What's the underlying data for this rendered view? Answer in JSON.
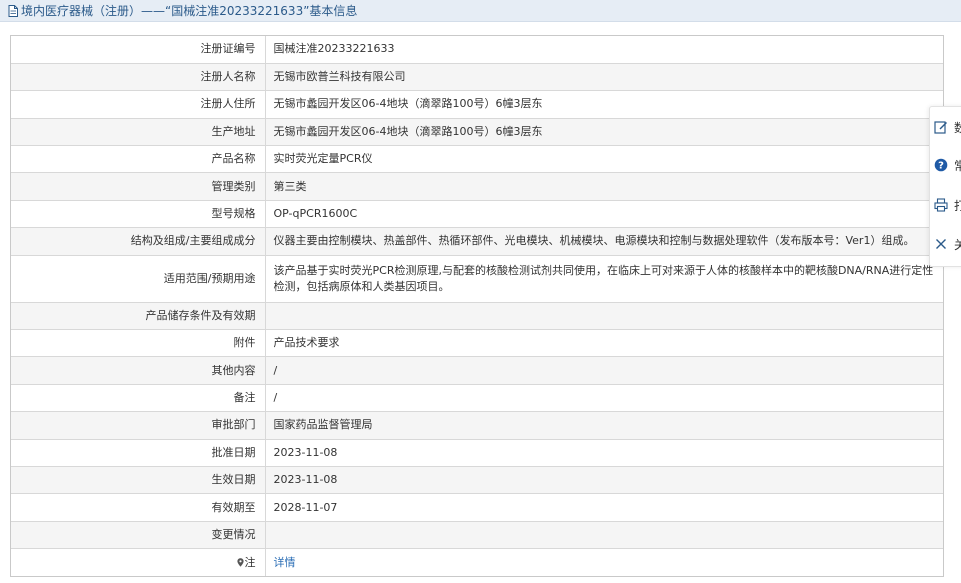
{
  "header": {
    "title": "境内医疗器械（注册）——“国械注准20233221633”基本信息"
  },
  "rows": [
    {
      "label": "注册证编号",
      "value": "国械注准20233221633"
    },
    {
      "label": "注册人名称",
      "value": "无锡市欧普兰科技有限公司"
    },
    {
      "label": "注册人住所",
      "value": "无锡市蠡园开发区06-4地块（滴翠路100号）6幢3层东"
    },
    {
      "label": "生产地址",
      "value": "无锡市蠡园开发区06-4地块（滴翠路100号）6幢3层东"
    },
    {
      "label": "产品名称",
      "value": "实时荧光定量PCR仪"
    },
    {
      "label": "管理类别",
      "value": "第三类"
    },
    {
      "label": "型号规格",
      "value": "OP-qPCR1600C"
    },
    {
      "label": "结构及组成/主要组成成分",
      "value": "仪器主要由控制模块、热盖部件、热循环部件、光电模块、机械模块、电源模块和控制与数据处理软件（发布版本号：Ver1）组成。"
    },
    {
      "label": "适用范围/预期用途",
      "value": "该产品基于实时荧光PCR检测原理,与配套的核酸检测试剂共同使用，在临床上可对来源于人体的核酸样本中的靶核酸DNA/RNA进行定性检测，包括病原体和人类基因项目。"
    },
    {
      "label": "产品储存条件及有效期",
      "value": ""
    },
    {
      "label": "附件",
      "value": "产品技术要求"
    },
    {
      "label": "其他内容",
      "value": "/"
    },
    {
      "label": "备注",
      "value": "/"
    },
    {
      "label": "审批部门",
      "value": "国家药品监督管理局"
    },
    {
      "label": "批准日期",
      "value": "2023-11-08"
    },
    {
      "label": "生效日期",
      "value": "2023-11-08"
    },
    {
      "label": "有效期至",
      "value": "2028-11-07"
    },
    {
      "label": "变更情况",
      "value": ""
    },
    {
      "label": "注",
      "value": "详情"
    }
  ],
  "sidebar": {
    "items": [
      {
        "label": "数",
        "icon": "edit-icon"
      },
      {
        "label": "常",
        "icon": "question-icon"
      },
      {
        "label": "打",
        "icon": "printer-icon"
      },
      {
        "label": "关",
        "icon": "close-icon"
      }
    ]
  },
  "colors": {
    "header_bg": "#e6edf5",
    "header_text": "#2b5a8a",
    "row_shade": "#f5f5f5",
    "link": "#2a6db5"
  }
}
